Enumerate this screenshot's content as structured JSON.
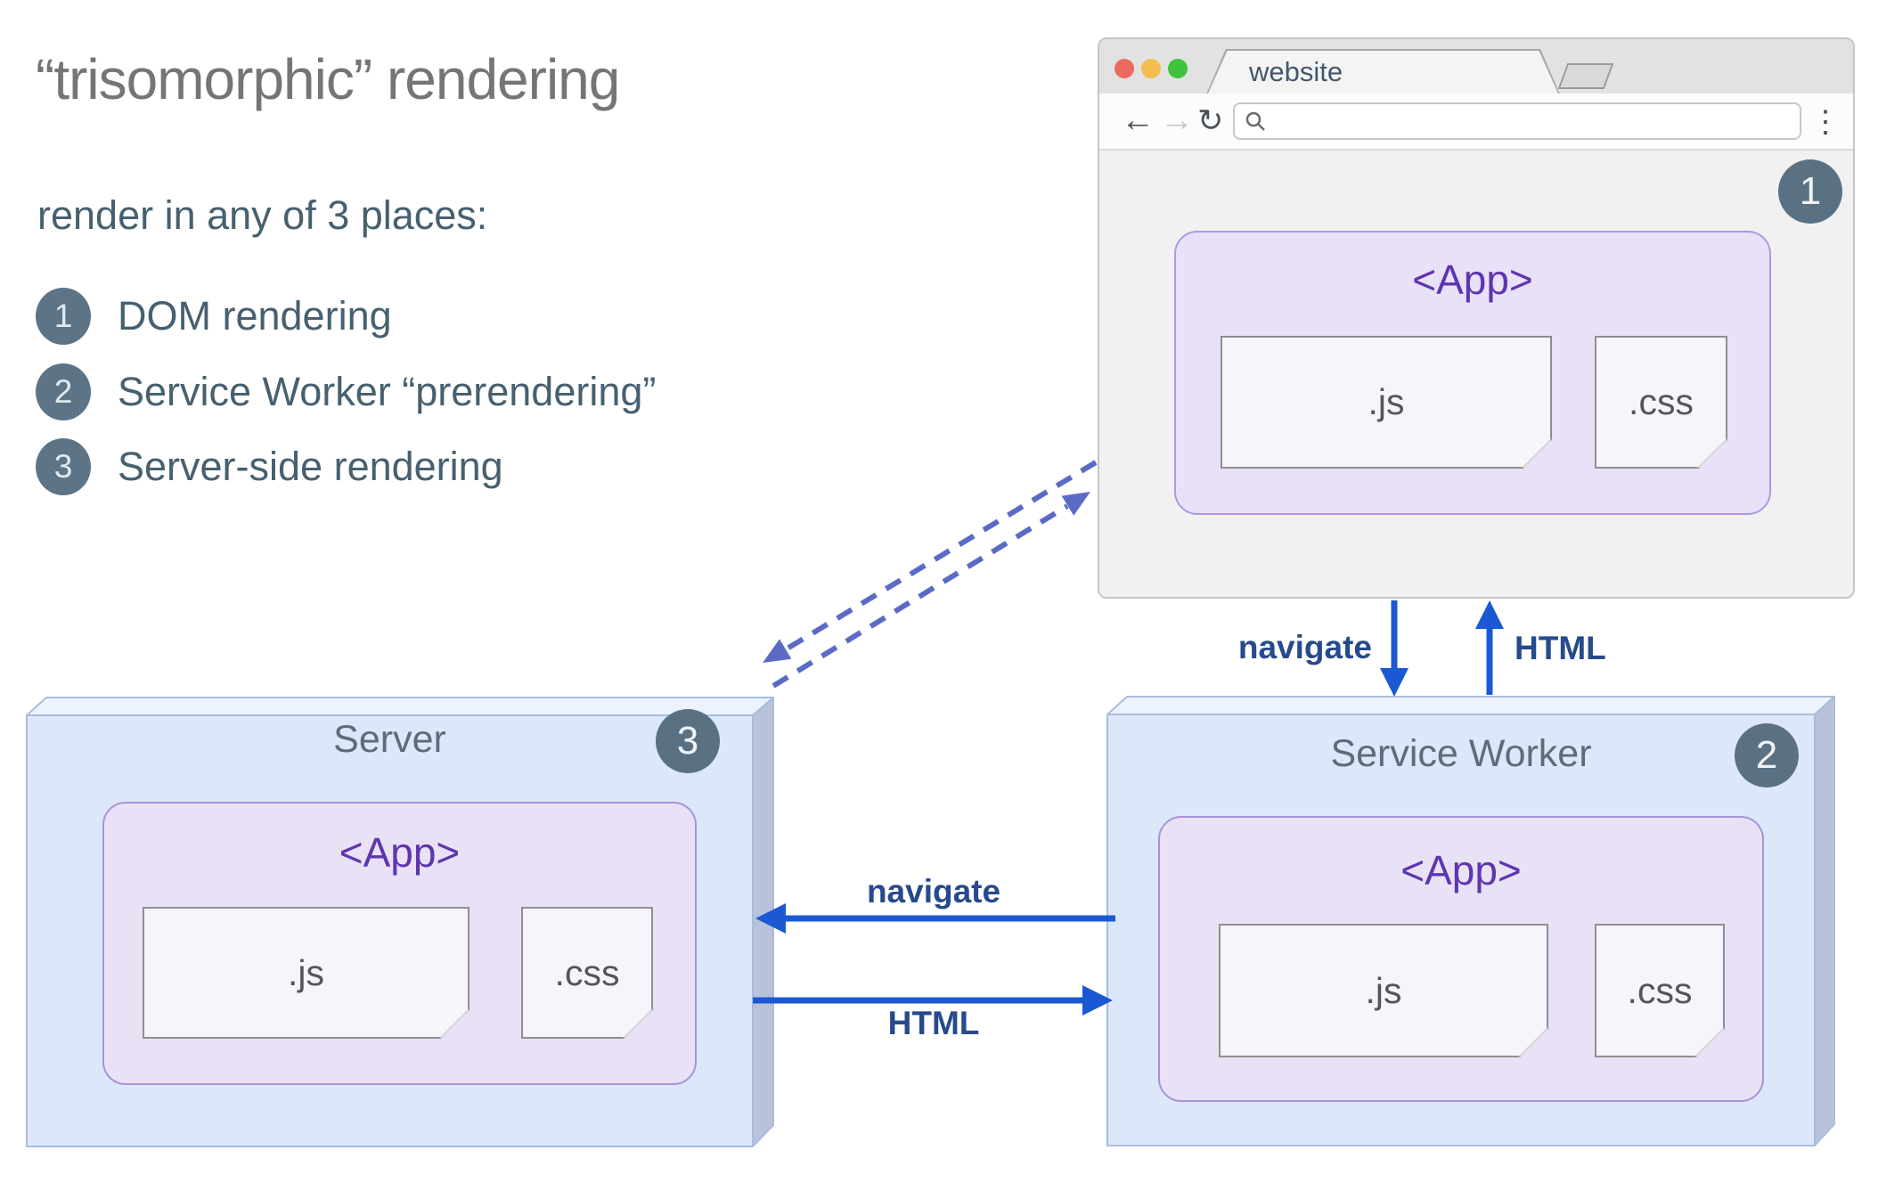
{
  "page": {
    "title": "“trisomorphic” rendering",
    "subtitle": "render in any of 3 places:"
  },
  "list": [
    {
      "num": "1",
      "label": "DOM rendering"
    },
    {
      "num": "2",
      "label": "Service Worker “prerendering”"
    },
    {
      "num": "3",
      "label": "Server-side rendering"
    }
  ],
  "browser": {
    "tab_title": "website",
    "badge": "1",
    "toolbar": {
      "back": "←",
      "forward": "→",
      "reload": "↻",
      "menu": "⋮"
    },
    "app": {
      "label": "<App>",
      "js": ".js",
      "css": ".css"
    }
  },
  "server": {
    "title": "Server",
    "badge": "3",
    "app": {
      "label": "<App>",
      "js": ".js",
      "css": ".css"
    }
  },
  "service_worker": {
    "title": "Service Worker",
    "badge": "2",
    "app": {
      "label": "<App>",
      "js": ".js",
      "css": ".css"
    }
  },
  "arrows": {
    "browser_to_sw": "navigate",
    "sw_to_browser": "HTML",
    "sw_to_server": "navigate",
    "server_to_sw": "HTML"
  },
  "colors": {
    "solid_arrow_blue": "#1b58d4",
    "dashed_arrow_indigo": "#5b6bc5",
    "badge_slate": "#5a7183",
    "app_purple_text": "#5e35b1",
    "box_face_blue": "#dce8f9",
    "title_gray": "#757575",
    "body_slate": "#47606f",
    "traffic_red": "#ed6a5e",
    "traffic_yellow": "#f5bd4f",
    "traffic_green": "#3fc23c"
  }
}
